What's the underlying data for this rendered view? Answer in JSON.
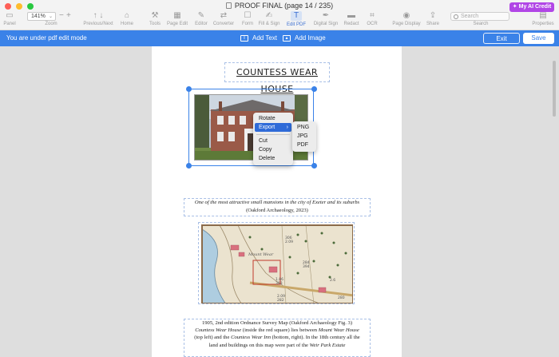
{
  "window": {
    "title": "PROOF FINAL (page 14 / 235)",
    "ai_credit": "My AI Credit"
  },
  "toolbar": {
    "zoom_value": "141%",
    "items": [
      {
        "label": "Panel",
        "icon": "panel-icon"
      },
      {
        "label": "Zoom",
        "icon": "zoom-icon"
      },
      {
        "label": "Previous/Next",
        "icon": "arrows-icon"
      },
      {
        "label": "Home",
        "icon": "home-icon"
      },
      {
        "label": "Tools",
        "icon": "tools-icon"
      },
      {
        "label": "Page Edit",
        "icon": "page-edit-icon"
      },
      {
        "label": "Editor",
        "icon": "editor-icon"
      },
      {
        "label": "Converter",
        "icon": "converter-icon"
      },
      {
        "label": "Form",
        "icon": "form-icon"
      },
      {
        "label": "Fill & Sign",
        "icon": "fill-sign-icon"
      },
      {
        "label": "Edit PDF",
        "icon": "edit-pdf-icon"
      },
      {
        "label": "Digital Sign",
        "icon": "digital-sign-icon"
      },
      {
        "label": "Redact",
        "icon": "redact-icon"
      },
      {
        "label": "OCR",
        "icon": "ocr-icon"
      },
      {
        "label": "Page Display",
        "icon": "page-display-icon"
      },
      {
        "label": "Share",
        "icon": "share-icon"
      },
      {
        "label": "Search",
        "icon": "search-icon"
      },
      {
        "label": "Properties",
        "icon": "properties-icon"
      }
    ],
    "search_placeholder": "Search"
  },
  "editbar": {
    "mode_text": "You are under pdf edit mode",
    "add_text": "Add Text",
    "add_image": "Add Image",
    "exit": "Exit",
    "save": "Save"
  },
  "document": {
    "heading": "COUNTESS WEAR HOUSE",
    "caption1_line1": "One of the most attractive small mansions in the city of Exeter and its suburbs",
    "caption1_line2": "(Oakford Archaeology, 2023)",
    "caption2_line1": "1905, 2nd edition Ordnance Survey Map (Oakford Archaeology Fig. 3)",
    "caption2_line2a": "Countess Wear House",
    "caption2_line2b": " (inside the red square) lies between ",
    "caption2_line2c": "Mount Wear House",
    "caption2_line3a": "(top left) and the ",
    "caption2_line3b": "Countess Wear Inn",
    "caption2_line3c": " (bottom, right). In the 18th century all the",
    "caption2_line4a": "land and buildings on this map were part of the ",
    "caption2_line4b": "Weir Park Estate",
    "map_labels": [
      "306",
      "2.09",
      "284",
      "394",
      "1.86",
      "303",
      "2.09",
      "282",
      "2.6",
      "280",
      "276",
      "Mount Wear"
    ]
  },
  "context_menu": {
    "items": [
      "Rotate",
      "Export",
      "Cut",
      "Copy",
      "Delete"
    ],
    "highlighted": "Export",
    "submenu": [
      "PNG",
      "JPG",
      "PDF"
    ]
  },
  "colors": {
    "accent": "#3a82e8",
    "ai_purple": "#b146e6"
  }
}
